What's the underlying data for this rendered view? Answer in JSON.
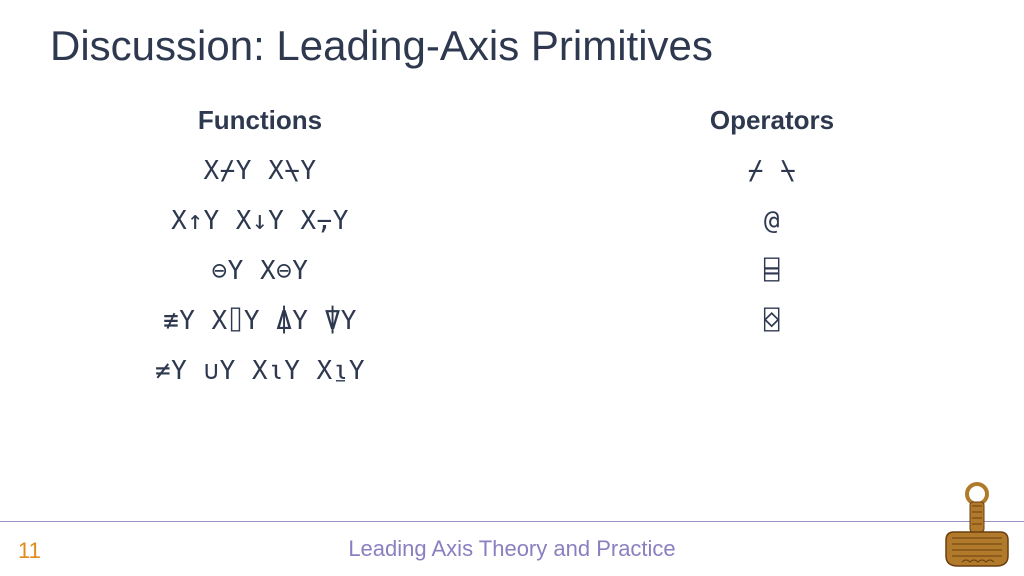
{
  "title": "Discussion: Leading-Axis Primitives",
  "columns": {
    "functions": {
      "heading": "Functions",
      "rows": [
        "X⌿Y  X⍀Y",
        "X↑Y  X↓Y  X⍪Y",
        "⊖Y  X⊖Y",
        "≢Y  X⌷Y  ⍋Y  ⍒Y",
        "≠Y  ∪Y  X⍳Y  X⍸Y"
      ]
    },
    "operators": {
      "heading": "Operators",
      "rows": [
        "⌿  ⍀",
        "@",
        "⌸",
        "⌺"
      ]
    }
  },
  "footer": {
    "page": "11",
    "title": "Leading Axis Theory and Practice"
  }
}
